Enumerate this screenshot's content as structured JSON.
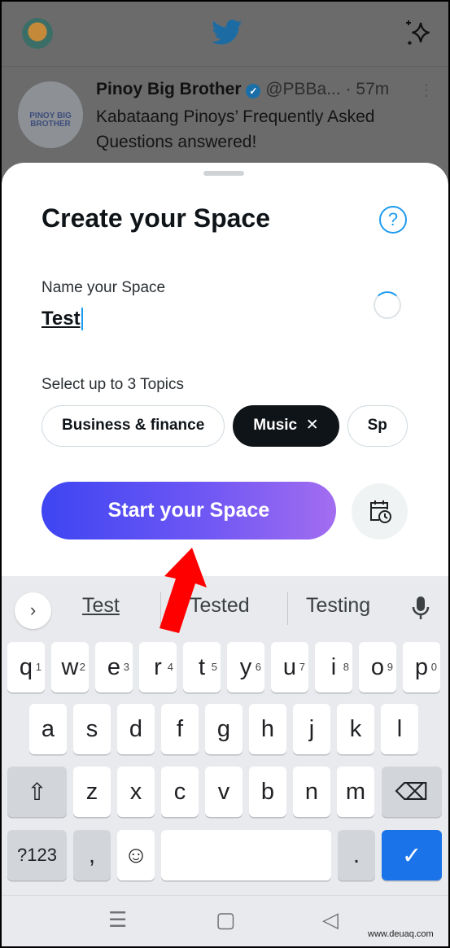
{
  "colors": {
    "accent": "#1d9bf0",
    "button_gradient_start": "#3e45f2",
    "button_gradient_end": "#a36df0",
    "enter_key": "#1a73e8",
    "arrow": "#ff0000"
  },
  "header": {
    "logo_icon": "twitter-bird-icon",
    "sparkle_icon": "sparkle-icon"
  },
  "tweet": {
    "avatar_text": "PINOY BIG BROTHER",
    "name": "Pinoy Big Brother",
    "handle": "@PBBa...",
    "time": "· 57m",
    "text": "Kabataang Pinoys’ Frequently Asked Questions answered!"
  },
  "sheet": {
    "title": "Create your Space",
    "help_icon": "?",
    "name_label": "Name your Space",
    "name_value": "Test",
    "topics_label": "Select up to 3 Topics",
    "topics": [
      {
        "label": "Business & finance",
        "selected": false
      },
      {
        "label": "Music",
        "selected": true,
        "remove": "✕"
      },
      {
        "label": "Sp",
        "selected": false
      }
    ],
    "start_label": "Start your Space"
  },
  "keyboard": {
    "expand": "›",
    "suggestions": [
      "Test",
      "Tested",
      "Testing"
    ],
    "rows": [
      [
        [
          "q",
          "1"
        ],
        [
          "w",
          "2"
        ],
        [
          "e",
          "3"
        ],
        [
          "r",
          "4"
        ],
        [
          "t",
          "5"
        ],
        [
          "y",
          "6"
        ],
        [
          "u",
          "7"
        ],
        [
          "i",
          "8"
        ],
        [
          "o",
          "9"
        ],
        [
          "p",
          "0"
        ]
      ],
      [
        [
          "a"
        ],
        [
          "s"
        ],
        [
          "d"
        ],
        [
          "f"
        ],
        [
          "g"
        ],
        [
          "h"
        ],
        [
          "j"
        ],
        [
          "k"
        ],
        [
          "l"
        ]
      ],
      [
        [
          "z"
        ],
        [
          "x"
        ],
        [
          "c"
        ],
        [
          "v"
        ],
        [
          "b"
        ],
        [
          "n"
        ],
        [
          "m"
        ]
      ]
    ],
    "shift": "⇧",
    "backspace": "⌫",
    "symbols": "?123",
    "comma": ",",
    "emoji": "☺",
    "period": ".",
    "enter": "✓"
  },
  "navbar": {
    "menu": "☰",
    "home": "▢",
    "back": "◁"
  },
  "watermark": "www.deuaq.com"
}
